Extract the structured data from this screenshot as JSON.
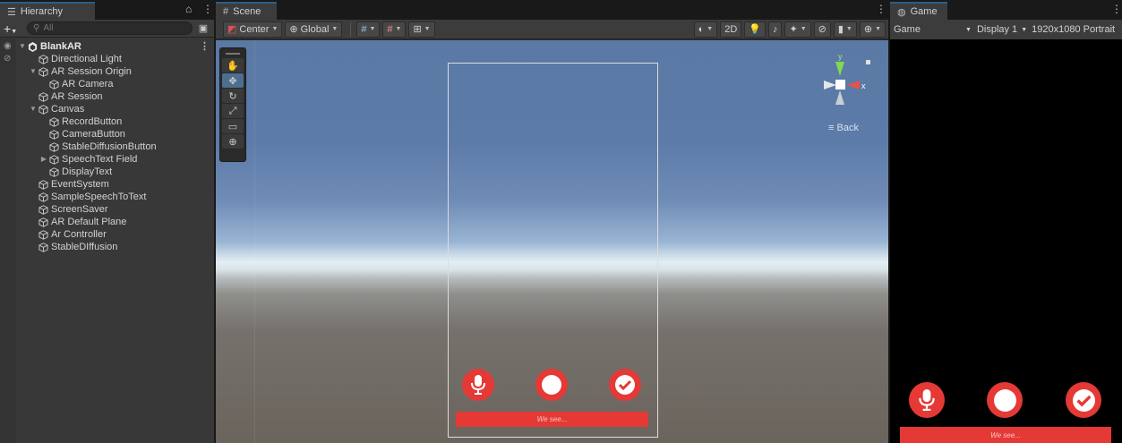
{
  "hierarchy": {
    "tab_label": "Hierarchy",
    "search_placeholder": "All",
    "add_label": "+",
    "root": "BlankAR",
    "items": [
      {
        "label": "Directional Light",
        "depth": 1,
        "expand": ""
      },
      {
        "label": "AR Session Origin",
        "depth": 1,
        "expand": "open"
      },
      {
        "label": "AR Camera",
        "depth": 2,
        "expand": ""
      },
      {
        "label": "AR Session",
        "depth": 1,
        "expand": ""
      },
      {
        "label": "Canvas",
        "depth": 1,
        "expand": "open"
      },
      {
        "label": "RecordButton",
        "depth": 2,
        "expand": ""
      },
      {
        "label": "CameraButton",
        "depth": 2,
        "expand": ""
      },
      {
        "label": "StableDiffusionButton",
        "depth": 2,
        "expand": ""
      },
      {
        "label": "SpeechText Field",
        "depth": 2,
        "expand": "closed"
      },
      {
        "label": "DisplayText",
        "depth": 2,
        "expand": ""
      },
      {
        "label": "EventSystem",
        "depth": 1,
        "expand": ""
      },
      {
        "label": "SampleSpeechToText",
        "depth": 1,
        "expand": ""
      },
      {
        "label": "ScreenSaver",
        "depth": 1,
        "expand": ""
      },
      {
        "label": "AR Default Plane",
        "depth": 1,
        "expand": ""
      },
      {
        "label": "Ar Controller",
        "depth": 1,
        "expand": ""
      },
      {
        "label": "StableDIffusion",
        "depth": 1,
        "expand": ""
      }
    ]
  },
  "scene": {
    "tab_label": "Scene",
    "pivot_label": "Center",
    "space_label": "Global",
    "mode_2d": "2D",
    "gizmo_y": "y",
    "gizmo_x": "x",
    "back_label": "Back",
    "caption": "We see..."
  },
  "game": {
    "tab_label": "Game",
    "mode": "Game",
    "display": "Display 1",
    "resolution": "1920x1080 Portrait",
    "caption": "We see..."
  },
  "colors": {
    "accent_red": "#e53935",
    "tab_accent": "#2c5d87"
  }
}
